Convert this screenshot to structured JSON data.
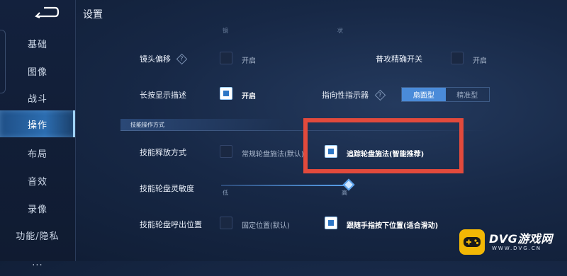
{
  "header": {
    "title": "设置"
  },
  "sidebar": {
    "items": [
      {
        "label": "基础"
      },
      {
        "label": "图像"
      },
      {
        "label": "战斗"
      },
      {
        "label": "操作",
        "active": true
      },
      {
        "label": "布局"
      },
      {
        "label": "音效"
      },
      {
        "label": "录像"
      },
      {
        "label": "功能/隐私"
      },
      {
        "label": "..."
      }
    ]
  },
  "settings": {
    "faint_top_left": "镜",
    "faint_top_right": "状",
    "lens_offset": {
      "label": "镜头偏移",
      "option": "开启",
      "checked": false
    },
    "normal_attack_precision": {
      "label": "普攻精确开关",
      "option": "开启",
      "checked": false
    },
    "long_press_desc": {
      "label": "长按显示描述",
      "option": "开启",
      "checked": true
    },
    "directional_indicator": {
      "label": "指向性指示器",
      "options": [
        "扇面型",
        "精准型"
      ],
      "selected": "扇面型"
    },
    "section_title": "技能操作方式",
    "skill_cast_mode": {
      "label": "技能释放方式",
      "option_a": "常规轮盘施法(默认)",
      "option_b": "追踪轮盘施法(智能推荐)",
      "selected": "option_b"
    },
    "wheel_sensitivity": {
      "label": "技能轮盘灵敏度",
      "min_label": "低",
      "max_label": "高",
      "value_fraction": 1.0
    },
    "wheel_position": {
      "label": "技能轮盘呼出位置",
      "option_a": "固定位置(默认)",
      "option_b": "跟随手指按下位置(适合滑动)",
      "selected": "option_b"
    }
  },
  "watermark": {
    "title": "DVG游戏网",
    "url": "WWW.DVG.CN"
  },
  "colors": {
    "accent": "#4a8bd9",
    "highlight": "#e24a3c",
    "watermark_badge": "#f2b705"
  }
}
